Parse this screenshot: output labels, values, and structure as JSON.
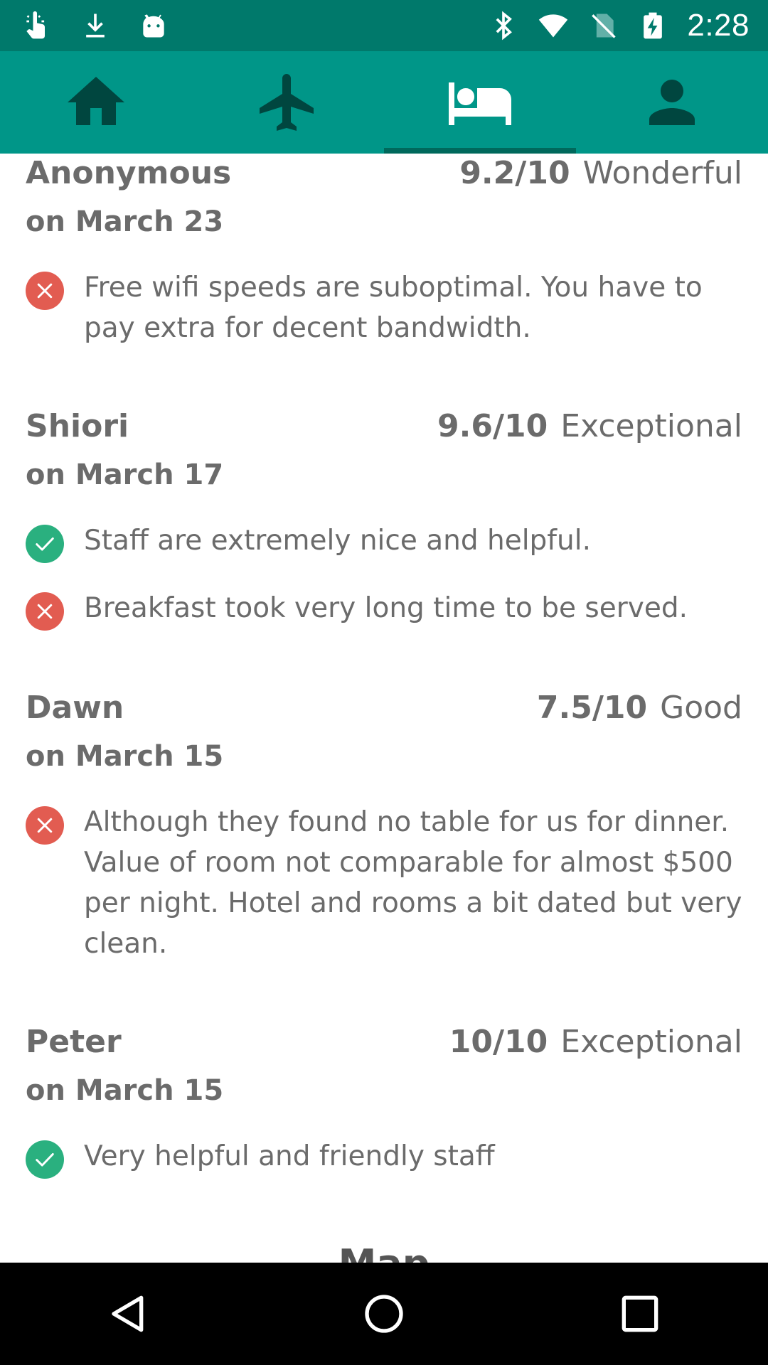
{
  "status_bar": {
    "time": "2:28",
    "left_icons": [
      "touch-gesture-icon",
      "download-icon",
      "android-icon"
    ],
    "right_icons": [
      "bluetooth-icon",
      "wifi-icon",
      "no-sim-icon",
      "battery-charging-icon"
    ]
  },
  "tab_bar": {
    "tabs": [
      {
        "icon": "home-icon",
        "selected": false
      },
      {
        "icon": "flight-icon",
        "selected": false
      },
      {
        "icon": "hotel-bed-icon",
        "selected": true
      },
      {
        "icon": "person-icon",
        "selected": false
      }
    ],
    "indicator_color": "#00695c"
  },
  "reviews": [
    {
      "name": "Anonymous",
      "score": "9.2/10",
      "label": "Wonderful",
      "date": "on March 23",
      "comments": [
        {
          "type": "negative",
          "text": "Free wifi speeds are suboptimal. You have to pay extra for decent bandwidth."
        }
      ]
    },
    {
      "name": "Shiori",
      "score": "9.6/10",
      "label": "Exceptional",
      "date": "on March 17",
      "comments": [
        {
          "type": "positive",
          "text": "Staff are extremely nice and helpful."
        },
        {
          "type": "negative",
          "text": "Breakfast took very long time to be served."
        }
      ]
    },
    {
      "name": "Dawn",
      "score": "7.5/10",
      "label": "Good",
      "date": "on March 15",
      "comments": [
        {
          "type": "negative",
          "text": "Although they found no table for us for dinner. Value of room not comparable for almost $500 per night. Hotel and rooms a bit dated but very clean."
        }
      ]
    },
    {
      "name": "Peter",
      "score": "10/10",
      "label": "Exceptional",
      "date": "on March 15",
      "comments": [
        {
          "type": "positive",
          "text": "Very helpful and friendly staff"
        }
      ]
    }
  ],
  "next_section": {
    "title": "Map"
  },
  "colors": {
    "status_bar": "#00796b",
    "tab_bar": "#009688",
    "negative": "#e25c51",
    "positive": "#2ab07f",
    "text": "#6b6b6b"
  },
  "nav_bar": {
    "buttons": [
      "back-icon",
      "home-circle-icon",
      "recents-square-icon"
    ]
  }
}
